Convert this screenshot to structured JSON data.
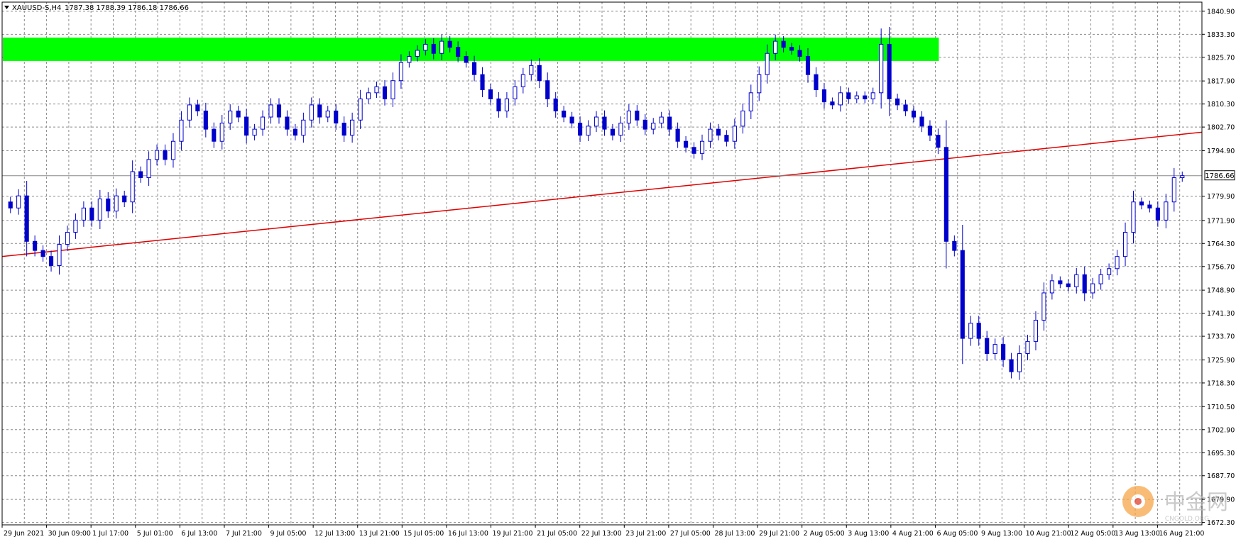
{
  "header": {
    "symbol": "XAUUSD-S,H4",
    "quote": "1787.38 1788.39 1786.18 1786.66"
  },
  "price_scale": {
    "current_price_label": "1786.66"
  },
  "watermark": {
    "brand": "中金网",
    "site": "CNGOLD.ORG"
  },
  "colors": {
    "candle": "#0000cc",
    "resistance_zone": "#00ff00",
    "trendline": "#e00000",
    "grid": "#8a8a8a",
    "axis": "#000000",
    "price_line": "#888888"
  },
  "chart_data": {
    "type": "candlestick",
    "symbol": "XAUUSD-S",
    "timeframe": "H4",
    "ylim": [
      1671.5,
      1843.9
    ],
    "grid": true,
    "y_ticks": [
      "1840.90",
      "1833.30",
      "1825.70",
      "1817.90",
      "1810.30",
      "1802.70",
      "1794.90",
      "1779.90",
      "1771.90",
      "1764.30",
      "1756.70",
      "1748.90",
      "1741.30",
      "1733.70",
      "1725.90",
      "1718.30",
      "1710.50",
      "1702.90",
      "1695.30",
      "1687.70",
      "1679.90",
      "1672.30"
    ],
    "x_ticks": [
      "29 Jun 2021",
      "30 Jun 09:00",
      "1 Jul 17:00",
      "5 Jul 01:00",
      "6 Jul 13:00",
      "7 Jul 21:00",
      "9 Jul 05:00",
      "12 Jul 13:00",
      "13 Jul 21:00",
      "15 Jul 05:00",
      "16 Jul 13:00",
      "19 Jul 21:00",
      "21 Jul 05:00",
      "22 Jul 13:00",
      "23 Jul 21:00",
      "27 Jul 05:00",
      "28 Jul 13:00",
      "29 Jul 21:00",
      "2 Aug 05:00",
      "3 Aug 13:00",
      "4 Aug 21:00",
      "6 Aug 05:00",
      "9 Aug 13:00",
      "10 Aug 21:00",
      "12 Aug 05:00",
      "13 Aug 13:00",
      "16 Aug 21:00"
    ],
    "current_price": 1786.66,
    "resistance_zone": {
      "low": 1824.5,
      "high": 1832.2
    },
    "trendline": {
      "from_price": 1760.0,
      "to_price": 1801.0
    },
    "closes": [
      1776.0,
      1780.0,
      1765.0,
      1762.0,
      1760.0,
      1757.0,
      1764.0,
      1768.0,
      1772.0,
      1776.0,
      1772.0,
      1779.0,
      1775.0,
      1780.0,
      1778.0,
      1788.0,
      1786.0,
      1792.0,
      1795.0,
      1792.0,
      1798.0,
      1805.0,
      1810.0,
      1808.0,
      1802.0,
      1798.0,
      1804.0,
      1808.0,
      1806.0,
      1800.0,
      1802.0,
      1806.0,
      1810.0,
      1806.0,
      1802.0,
      1800.0,
      1805.0,
      1810.0,
      1806.0,
      1808.0,
      1804.0,
      1800.0,
      1805.0,
      1812.0,
      1814.0,
      1816.0,
      1812.0,
      1818.0,
      1824.0,
      1826.0,
      1828.0,
      1830.0,
      1827.0,
      1831.0,
      1829.0,
      1826.0,
      1824.0,
      1820.0,
      1815.0,
      1812.0,
      1808.0,
      1812.0,
      1816.0,
      1820.0,
      1823.0,
      1818.0,
      1812.0,
      1808.0,
      1806.0,
      1804.0,
      1800.0,
      1803.0,
      1806.0,
      1802.0,
      1800.0,
      1804.0,
      1808.0,
      1805.0,
      1802.0,
      1804.0,
      1806.0,
      1802.0,
      1798.0,
      1796.0,
      1794.0,
      1798.0,
      1802.0,
      1800.0,
      1798.0,
      1803.0,
      1808.0,
      1814.0,
      1820.0,
      1827.0,
      1831.0,
      1829.0,
      1828.0,
      1826.0,
      1820.0,
      1815.0,
      1811.0,
      1810.0,
      1814.0,
      1812.0,
      1813.0,
      1812.0,
      1814.0,
      1830.0,
      1812.0,
      1810.0,
      1808.0,
      1806.0,
      1803.0,
      1800.0,
      1796.0,
      1765.0,
      1762.0,
      1733.0,
      1738.0,
      1733.0,
      1728.0,
      1731.0,
      1726.0,
      1722.0,
      1728.0,
      1732.0,
      1739.0,
      1748.0,
      1752.0,
      1751.0,
      1750.0,
      1754.0,
      1748.0,
      1751.0,
      1754.0,
      1756.0,
      1760.0,
      1768.0,
      1778.0,
      1777.0,
      1776.0,
      1772.0,
      1778.0,
      1786.0,
      1786.66
    ]
  }
}
